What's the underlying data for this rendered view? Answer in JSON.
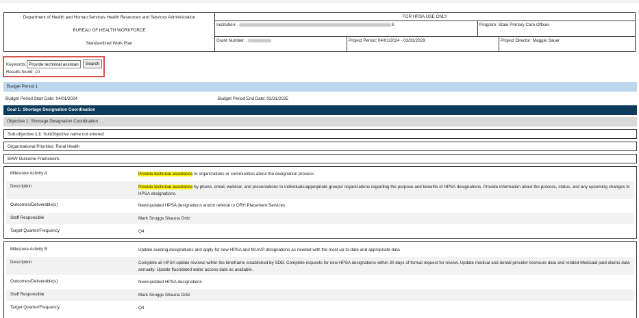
{
  "header": {
    "dept": "Department of Health and Human Services Health Resources and Services Administration",
    "bureau": "BUREAU OF HEALTH WORKFORCE",
    "plan": "Standardized Work Plan",
    "hrsa_only": "FOR HRSA USE ONLY",
    "institution_label": "Institution:",
    "institution_tail": "S",
    "program": "Program: State Primary Care Offices",
    "grant_label": "Grant Number:",
    "project_period": "Project Period: 04/01/2024 - 03/31/2029",
    "project_director": "Project Director: Maggie Sauer"
  },
  "search": {
    "label": "Keywords:",
    "value": "Provide technical assistanc",
    "button": "Search",
    "results": "Results found: 10"
  },
  "budget_period": {
    "title": "Budget Period 1",
    "start": "Budget Period Start Date: 04/01/2024",
    "end": "Budget Period End Date: 03/31/2025"
  },
  "goal": "Goal 1: Shortage Designation Coordination",
  "objective": "Objective 1: Shortage Designation Coordination",
  "subobjective": {
    "prefix": "Sub-objective ",
    "num": "1.1",
    "rest": ": SubObjective name not entered"
  },
  "org_priorities": "Organizational Priorities: Rural Health",
  "bhw_framework": "BHW Outcome Framework:",
  "milestones": {
    "a": {
      "label_activity": "Milestone Activity A",
      "activity_hl": "Provide technical assistance",
      "activity_rest": " to organizations or communities about the designation process",
      "label_description": "Description",
      "description_hl": "Provide technical assistance",
      "description_rest": " by phone, email, webinar, and presentations to individuals/appropriate groups/ organizations regarding the purpose and benefits of HPSA designations. Provide information about the process, status, and any upcoming changes to HPSA designations.",
      "label_outcomes": "Outcomes/Deliverable(s)",
      "outcomes": "New/updated HPSA designations and/or referral to ORH Placement Services",
      "label_staff": "Staff Responsible",
      "staff": "Mark Snuggs Shauna Ortiz",
      "label_target": "Target Quarter/Frequency",
      "target": "Q4"
    },
    "b": {
      "label_activity": "Milestone Activity B",
      "activity": "Update existing designations and apply for new HPSA and MUA/P designations as needed with the most up-to-date and appropriate data",
      "label_description": "Description",
      "description": "Complete all HPSA update reviews within the timeframe established by SDB. Complete requests for new HPSA designations within 30 days of formal request for review. Update medical and dental provider licensure data and related Medicaid paid claims data annually. Update fluoridated water access data as available.",
      "label_outcomes": "Outcomes/Deliverable(s)",
      "outcomes": "New/updated HPSA designations",
      "label_staff": "Staff Responsible",
      "staff": "Mark Snuggs Shauna Ortiz",
      "label_target": "Target Quarter/Frequency",
      "target": "Q4"
    }
  }
}
